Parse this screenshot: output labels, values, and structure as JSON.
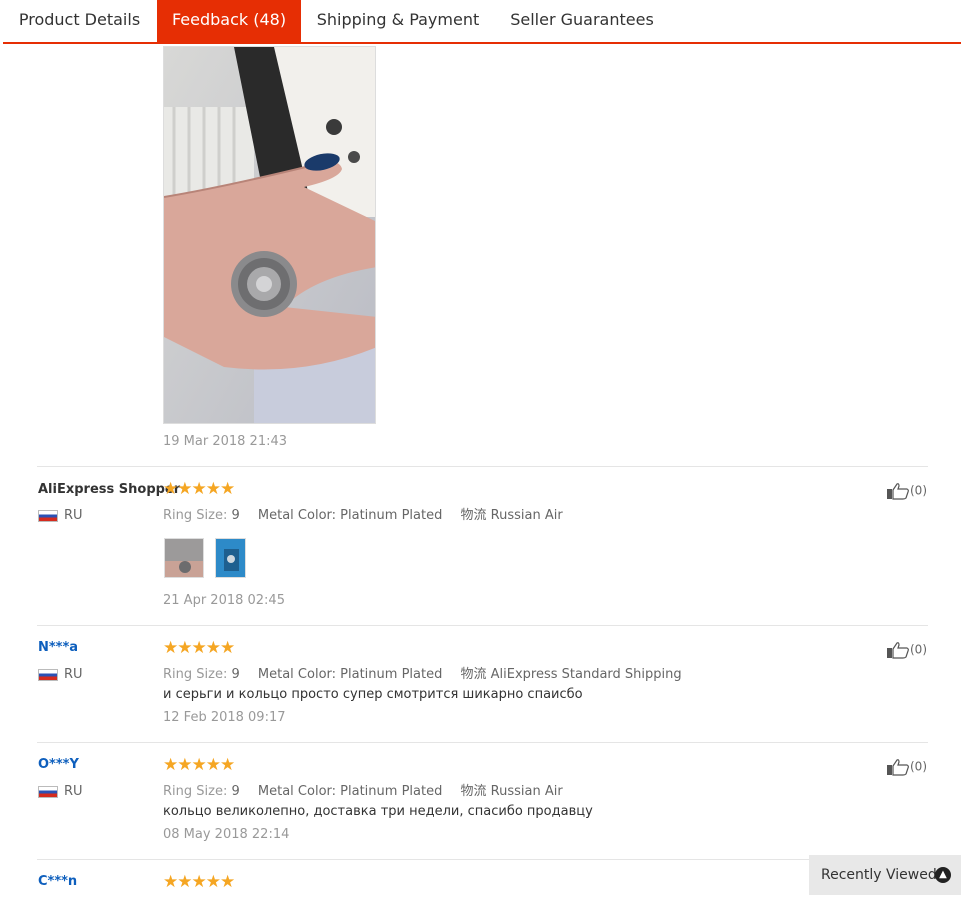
{
  "tabs": [
    {
      "label": "Product Details"
    },
    {
      "label": "Feedback (48)"
    },
    {
      "label": "Shipping & Payment"
    },
    {
      "label": "Seller Guarantees"
    }
  ],
  "first_review": {
    "date": "19 Mar 2018 21:43"
  },
  "attr_labels": {
    "ring_size": "Ring Size:",
    "metal_color": "Metal Color:",
    "shipping": "物流"
  },
  "reviews": [
    {
      "user": "AliExpress Shopper",
      "country": "RU",
      "ring_size": "9",
      "metal_color": "Platinum Plated",
      "shipping": "Russian Air",
      "text": "",
      "date": "21 Apr 2018 02:45",
      "helpful": "(0)"
    },
    {
      "user": "N***a",
      "country": "RU",
      "ring_size": "9",
      "metal_color": "Platinum Plated",
      "shipping": "AliExpress Standard Shipping",
      "text": "и серьги и кольцо просто супер смотрится шикарно спаисбо",
      "date": "12 Feb 2018 09:17",
      "helpful": "(0)"
    },
    {
      "user": "O***Y",
      "country": "RU",
      "ring_size": "9",
      "metal_color": "Platinum Plated",
      "shipping": "Russian Air",
      "text": "кольцо великолепно, доставка три недели, спасибо продавцу",
      "date": "08 May 2018 22:14",
      "helpful": "(0)"
    },
    {
      "user": "C***n",
      "country": "",
      "ring_size": "",
      "metal_color": "",
      "shipping": "",
      "text": "",
      "date": "",
      "helpful": ""
    }
  ],
  "stars": "★★★★★",
  "recently_viewed": {
    "label": "Recently Viewed"
  },
  "colors": {
    "accent": "#e62e04",
    "star": "#f5a623",
    "link": "#0e5fbd"
  }
}
